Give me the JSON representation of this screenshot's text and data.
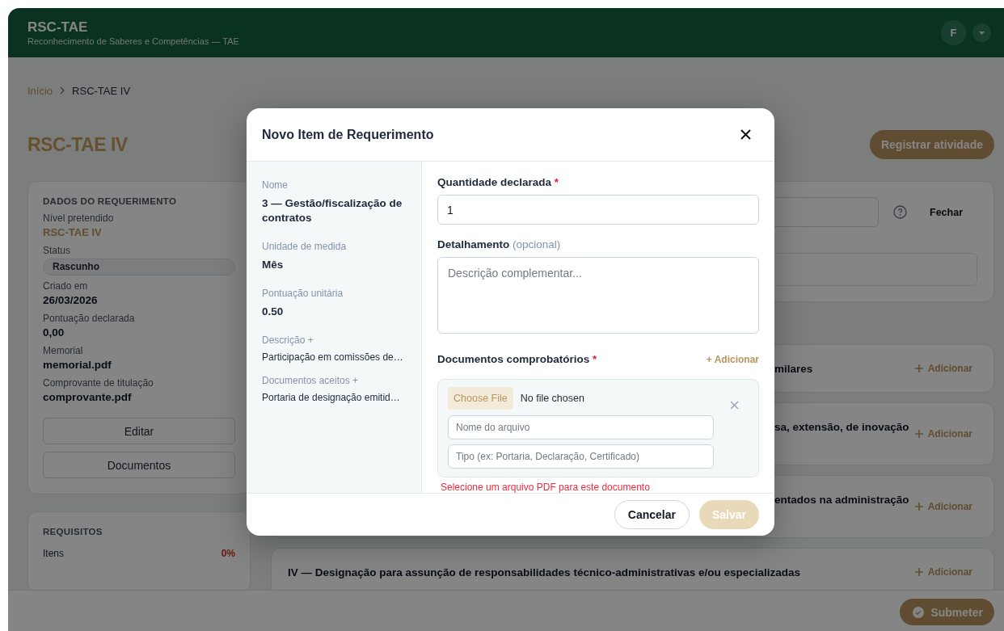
{
  "header": {
    "title": "RSC-TAE",
    "subtitle": "Reconhecimento de Saberes e Competências — TAE",
    "avatar": "F"
  },
  "breadcrumb": [
    {
      "label": "Início",
      "kind": "link"
    },
    {
      "label": "RSC-TAE IV",
      "kind": "current"
    }
  ],
  "page_title": "RSC-TAE IV",
  "primary_action": "Registrar atividade",
  "request_card": {
    "title": "DADOS DO REQUERIMENTO",
    "fields": [
      {
        "label": "Nível pretendido",
        "value": "RSC-TAE IV",
        "kind": "highlight"
      },
      {
        "label": "Status",
        "value": "Rascunho",
        "kind": "pill"
      },
      {
        "label": "Criado em",
        "value": "26/03/2026",
        "kind": "text"
      },
      {
        "label": "Pontuação declarada",
        "value": "0,00",
        "kind": "text"
      },
      {
        "label": "Memorial",
        "value": "memorial.pdf",
        "kind": "text"
      },
      {
        "label": "Comprovante de titulação",
        "value": "comprovante.pdf",
        "kind": "text"
      }
    ],
    "buttons": [
      "Editar",
      "Documentos"
    ]
  },
  "requirements_card": {
    "title": "REQUISITOS",
    "rows": [
      {
        "label": "Itens",
        "value": "0%"
      }
    ]
  },
  "filter_panel": {
    "close_label": "Fechar"
  },
  "sections": [
    {
      "title": "milares",
      "action": "Adicionar",
      "kind": "covered"
    },
    {
      "title": "sa, extensão, de inovação",
      "action": "Adicionar",
      "kind": "covered-tall"
    },
    {
      "title": "entados na administração",
      "action": "Adicionar",
      "kind": "covered-tall"
    },
    {
      "title": "IV — Designação para assunção de responsabilidades técnico-administrativas e/ou especializadas",
      "action": "Adicionar",
      "kind": "full"
    }
  ],
  "submit_label": "Submeter",
  "modal": {
    "title": "Novo Item de Requerimento",
    "details": [
      {
        "label": "Nome",
        "value": "3 — Gestão/fiscalização de contratos",
        "kind": "strong"
      },
      {
        "label": "Unidade de medida",
        "value": "Mês",
        "kind": "strong"
      },
      {
        "label": "Pontuação unitária",
        "value": "0.50",
        "kind": "strong"
      },
      {
        "label": "Descrição +",
        "value": "Participação em comissões de…",
        "kind": "plain"
      },
      {
        "label": "Documentos aceitos +",
        "value": "Portaria de designação emitid…",
        "kind": "plain"
      }
    ],
    "quantity": {
      "label": "Quantidade declarada",
      "required_mark": "*",
      "value": "1"
    },
    "detail": {
      "label": "Detalhamento",
      "hint": "(opcional)",
      "placeholder": "Descrição complementar..."
    },
    "documents": {
      "label": "Documentos comprobatórios",
      "required_mark": "*",
      "add_label": "+ Adicionar",
      "items": [
        {
          "choose_label": "Choose File",
          "file_status": "No file chosen",
          "name_placeholder": "Nome do arquivo",
          "type_placeholder": "Tipo (ex: Portaria, Declaração, Certificado)"
        }
      ],
      "error": "Selecione um arquivo PDF para este documento"
    },
    "buttons": [
      {
        "label": "Cancelar",
        "kind": "secondary",
        "disabled": false
      },
      {
        "label": "Salvar",
        "kind": "primary",
        "disabled": true
      }
    ]
  }
}
